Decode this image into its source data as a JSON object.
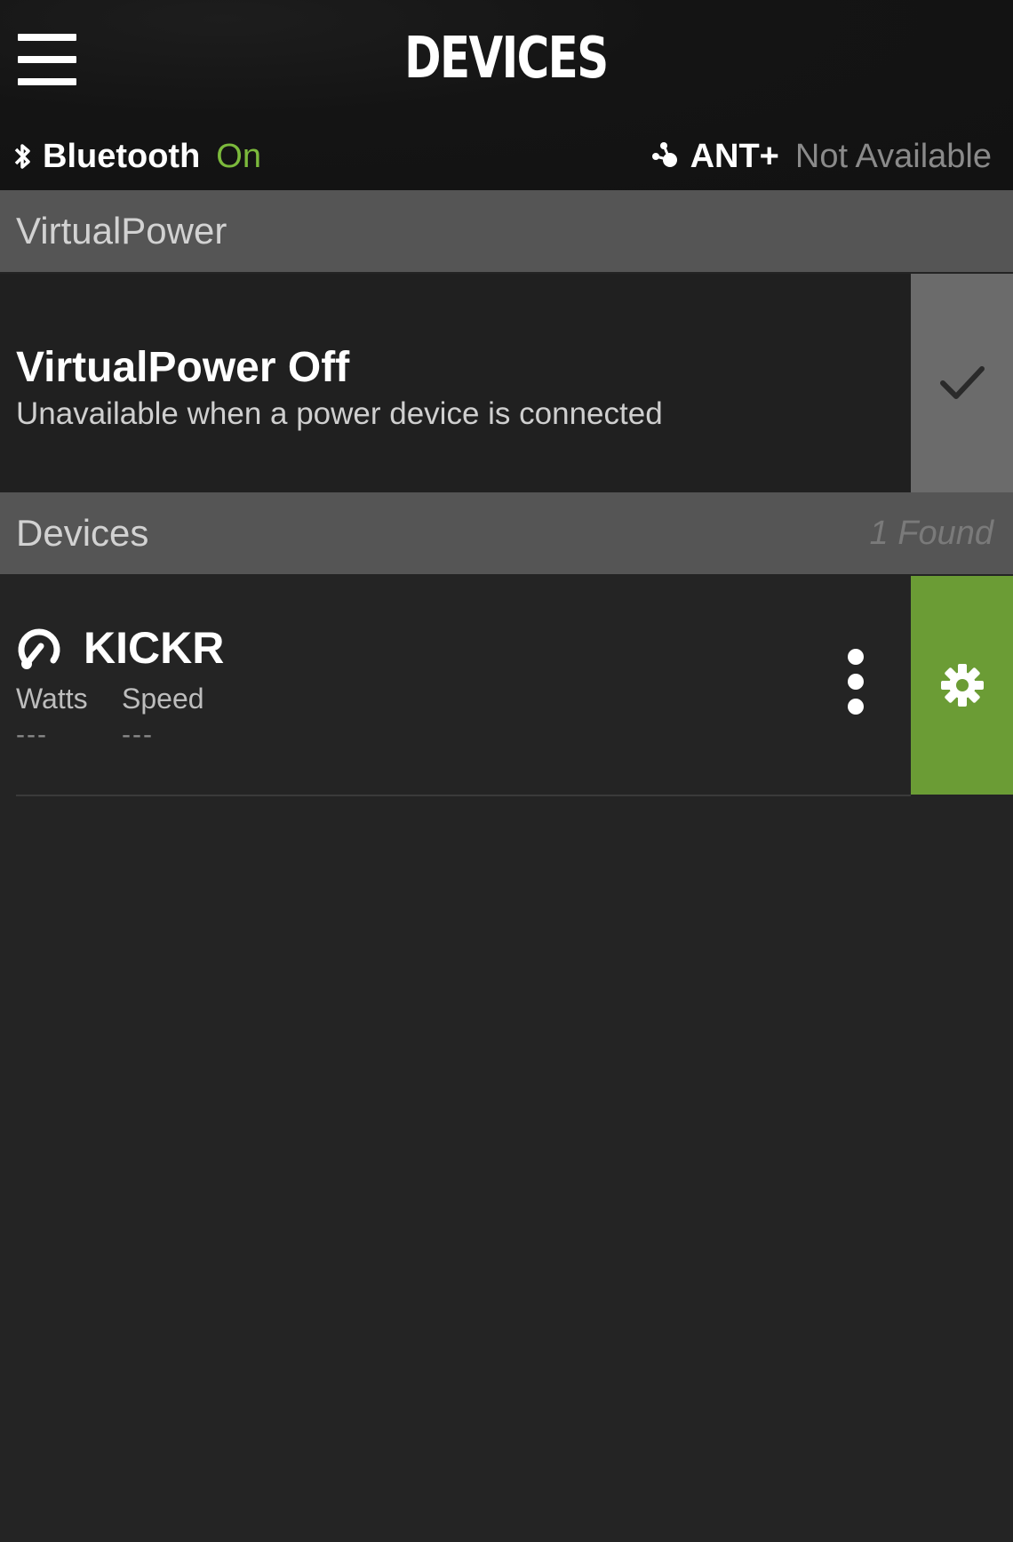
{
  "header": {
    "title": "DEVICES",
    "menu_icon": "hamburger-menu-icon"
  },
  "status": {
    "bluetooth": {
      "icon": "bluetooth-icon",
      "label": "Bluetooth",
      "value": "On",
      "value_color": "#7cba3c"
    },
    "ant": {
      "icon": "ant-plus-icon",
      "label": "ANT+",
      "value": "Not Available"
    }
  },
  "virtualpower_section": {
    "title": "VirtualPower",
    "item": {
      "title": "VirtualPower Off",
      "subtitle": "Unavailable when a power device is connected",
      "selected": true,
      "check_icon": "checkmark-icon"
    }
  },
  "devices_section": {
    "title": "Devices",
    "count": "1 Found",
    "devices": [
      {
        "name": "KICKR",
        "icon": "kickr-trainer-icon",
        "metrics": [
          {
            "label": "Watts",
            "value": "---"
          },
          {
            "label": "Speed",
            "value": "---"
          }
        ],
        "more_icon": "more-vertical-icon",
        "settings_icon": "gear-icon",
        "settings_color": "#6b9c35"
      }
    ]
  }
}
